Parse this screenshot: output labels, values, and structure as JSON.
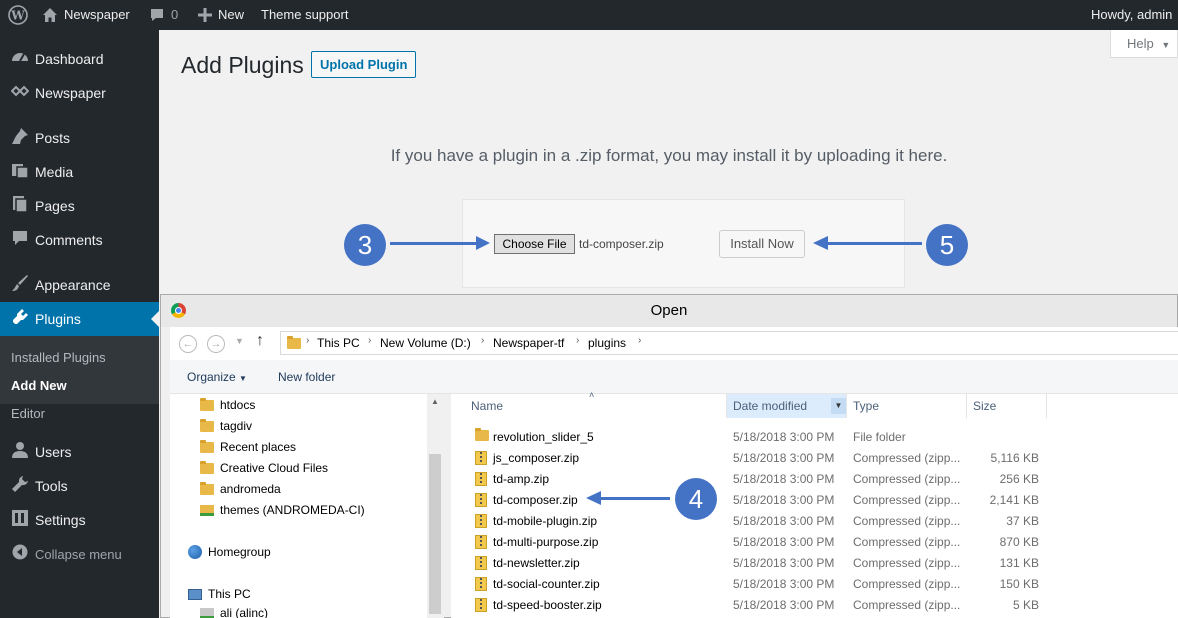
{
  "adminbar": {
    "site_name": "Newspaper",
    "comments_count": "0",
    "new_label": "New",
    "theme_support": "Theme support",
    "howdy": "Howdy, admin"
  },
  "sidebar": {
    "items": [
      {
        "label": "Dashboard",
        "icon": "dashboard-icon"
      },
      {
        "label": "Newspaper",
        "icon": "newspaper-icon"
      },
      {
        "label": "Posts",
        "icon": "pin-icon"
      },
      {
        "label": "Media",
        "icon": "media-icon"
      },
      {
        "label": "Pages",
        "icon": "pages-icon"
      },
      {
        "label": "Comments",
        "icon": "comment-icon"
      },
      {
        "label": "Appearance",
        "icon": "brush-icon"
      },
      {
        "label": "Plugins",
        "icon": "plugin-icon"
      },
      {
        "label": "Users",
        "icon": "user-icon"
      },
      {
        "label": "Tools",
        "icon": "wrench-icon"
      },
      {
        "label": "Settings",
        "icon": "settings-icon"
      }
    ],
    "submenu": [
      "Installed Plugins",
      "Add New",
      "Editor"
    ],
    "collapse_label": "Collapse menu"
  },
  "main": {
    "title": "Add Plugins",
    "upload_button": "Upload Plugin",
    "help_label": "Help",
    "upload_text": "If you have a plugin in a .zip format, you may install it by uploading it here.",
    "choose_file_label": "Choose File",
    "chosen_file": "td-composer.zip",
    "install_label": "Install Now"
  },
  "steps": {
    "choose": "3",
    "pick": "4",
    "install": "5"
  },
  "dialog": {
    "title": "Open",
    "breadcrumbs": [
      "This PC",
      "New Volume (D:)",
      "Newspaper-tf",
      "plugins"
    ],
    "organize_label": "Organize",
    "new_folder_label": "New folder",
    "tree": [
      "htdocs",
      "tagdiv",
      "Recent places",
      "Creative Cloud Files",
      "andromeda",
      "themes (ANDROMEDA-CI)",
      "Homegroup",
      "This PC",
      "ali (alinc)"
    ],
    "columns": [
      "Name",
      "Date modified",
      "Type",
      "Size"
    ],
    "files": [
      {
        "name": "revolution_slider_5",
        "date": "5/18/2018 3:00 PM",
        "type": "File folder",
        "size": ""
      },
      {
        "name": "js_composer.zip",
        "date": "5/18/2018 3:00 PM",
        "type": "Compressed (zipp...",
        "size": "5,116 KB"
      },
      {
        "name": "td-amp.zip",
        "date": "5/18/2018 3:00 PM",
        "type": "Compressed (zipp...",
        "size": "256 KB"
      },
      {
        "name": "td-composer.zip",
        "date": "5/18/2018 3:00 PM",
        "type": "Compressed (zipp...",
        "size": "2,141 KB"
      },
      {
        "name": "td-mobile-plugin.zip",
        "date": "5/18/2018 3:00 PM",
        "type": "Compressed (zipp...",
        "size": "37 KB"
      },
      {
        "name": "td-multi-purpose.zip",
        "date": "5/18/2018 3:00 PM",
        "type": "Compressed (zipp...",
        "size": "870 KB"
      },
      {
        "name": "td-newsletter.zip",
        "date": "5/18/2018 3:00 PM",
        "type": "Compressed (zipp...",
        "size": "131 KB"
      },
      {
        "name": "td-social-counter.zip",
        "date": "5/18/2018 3:00 PM",
        "type": "Compressed (zipp...",
        "size": "150 KB"
      },
      {
        "name": "td-speed-booster.zip",
        "date": "5/18/2018 3:00 PM",
        "type": "Compressed (zipp...",
        "size": "5 KB"
      }
    ]
  },
  "colors": {
    "accent": "#0073aa",
    "step": "#4472c4",
    "sidebar": "#23282d"
  }
}
